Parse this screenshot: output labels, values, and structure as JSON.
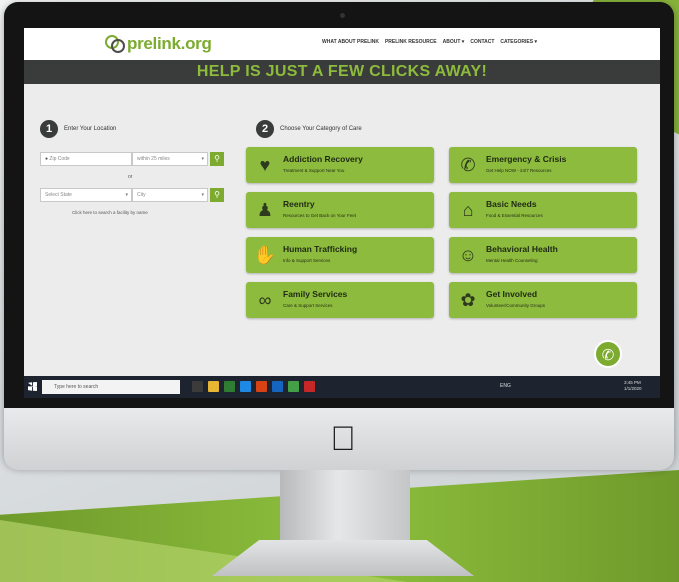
{
  "site": {
    "logo_text": "prelink.org",
    "nav": [
      "WHAT ABOUT PRELINK",
      "PRELINK RESOURCE",
      "ABOUT ▾",
      "CONTACT",
      "CATEGORIES ▾"
    ],
    "banner": "HELP IS JUST A FEW CLICKS AWAY!"
  },
  "location": {
    "step_number": "1",
    "step_label": "Enter Your Location",
    "zip_placeholder": "Zip Code",
    "radius_value": "within 25 miles",
    "or_text": "or",
    "state_value": "Select State",
    "city_value": "City",
    "hint": "Click here to search a facility by name"
  },
  "category": {
    "step_number": "2",
    "step_label": "Choose Your Category of Care",
    "items": [
      {
        "title": "Addiction Recovery",
        "subtitle": "Treatment & Support Near You",
        "icon": "hand-heart-icon"
      },
      {
        "title": "Emergency & Crisis",
        "subtitle": "Get Help NOW - 24/7 Resources",
        "icon": "emergency-icon"
      },
      {
        "title": "Reentry",
        "subtitle": "Resources to Get Back on Your Feet",
        "icon": "group-icon"
      },
      {
        "title": "Basic Needs",
        "subtitle": "Food & Essential Resources",
        "icon": "basic-needs-icon"
      },
      {
        "title": "Human Trafficking",
        "subtitle": "Info & Support Services",
        "icon": "hand-stop-icon"
      },
      {
        "title": "Behavioral Health",
        "subtitle": "Mental Health Counseling",
        "icon": "head-icon"
      },
      {
        "title": "Family Services",
        "subtitle": "Care & Support Services",
        "icon": "family-icon"
      },
      {
        "title": "Get Involved",
        "subtitle": "Volunteer/Community Groups",
        "icon": "community-icon"
      }
    ]
  },
  "taskbar": {
    "search_placeholder": "Type here to search",
    "tray": "ENG",
    "time": "3:45 PM",
    "date": "1/1/2020"
  },
  "colors": {
    "accent_green": "#8cbb3d",
    "banner_dark": "#3a3b3b",
    "banner_text": "#8dbb3c"
  }
}
